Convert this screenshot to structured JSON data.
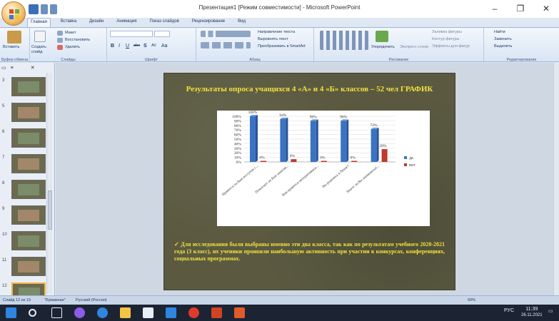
{
  "window": {
    "title": "Презентация1 [Режим совместимости] - Microsoft PowerPoint",
    "minimize": "–",
    "maximize": "❐",
    "close": "✕"
  },
  "tabs": [
    "Главная",
    "Вставка",
    "Дизайн",
    "Анимация",
    "Показ слайдов",
    "Рецензирование",
    "Вид"
  ],
  "ribbon": {
    "clipboard": {
      "paste": "Вставить",
      "label": "Буфер обмена"
    },
    "slides": {
      "create": "Создать слайд",
      "layout": "Макет",
      "restore": "Восстановить",
      "delete": "Удалить",
      "label": "Слайды"
    },
    "font": {
      "bold": "B",
      "italic": "I",
      "underline": "U",
      "strike": "abe",
      "shadow": "S",
      "spacing": "AV",
      "case": "Aa",
      "label": "Шрифт"
    },
    "paragraph": {
      "label": "Абзац",
      "direction": "Направление текста",
      "align": "Выровнять текст",
      "smartart": "Преобразовать в SmartArt"
    },
    "drawing": {
      "arrange": "Упорядочить",
      "styles": "Экспресс-стили",
      "fill": "Заливка фигуры",
      "outline": "Контур фигуры",
      "effects": "Эффекты для фигур",
      "label": "Рисование"
    },
    "editing": {
      "find": "Найти",
      "replace": "Заменить",
      "select": "Выделить",
      "label": "Редактирование"
    }
  },
  "slides_pane": {
    "numbers": [
      "3",
      "5",
      "6",
      "7",
      "8",
      "9",
      "10",
      "11",
      "12"
    ]
  },
  "slide": {
    "title": "Результаты опроса учащихся 4 «А» и 4 «Б» классов – 52 чел ГРАФИК",
    "body": "✓   Для исследования были выбраны именно эти два класса, так как по результатам учебного 2020-2021 года (3 класс), их ученики проявили наибольшую активность при участии в конкурсах, конференциях, социальных программах."
  },
  "chart_data": {
    "type": "bar",
    "categories": [
      "Нравится ли Вам поступок с...",
      "Помогают ли Вам занятия...",
      "Вам нравится интерактивное...",
      "Вы родились в Пензе?",
      "Знаете ли Вы знаменитых..."
    ],
    "series": [
      {
        "name": "да",
        "values": [
          100,
          94,
          90,
          90,
          72
        ],
        "color": "#3b73c4"
      },
      {
        "name": "нет",
        "values": [
          0,
          6,
          0,
          0,
          28
        ],
        "color": "#c0392b"
      }
    ],
    "data_labels": {
      "да": [
        "100%",
        "94%",
        "90%",
        "90%",
        "72%"
      ],
      "нет": [
        "0%",
        "6%",
        "0%",
        "0%",
        "28%"
      ]
    },
    "yticks": [
      "0%",
      "10%",
      "20%",
      "30%",
      "40%",
      "50%",
      "60%",
      "70%",
      "80%",
      "90%",
      "100%"
    ],
    "ylim": [
      0,
      100
    ],
    "legend_position": "right"
  },
  "status": {
    "slide": "Слайд 12 из 19",
    "theme": "\"Бумажная\"",
    "language": "Русский (Россия)",
    "zoom": "69%"
  },
  "taskbar": {
    "lang": "РУС",
    "time": "11:39",
    "date": "26.11.2021"
  }
}
